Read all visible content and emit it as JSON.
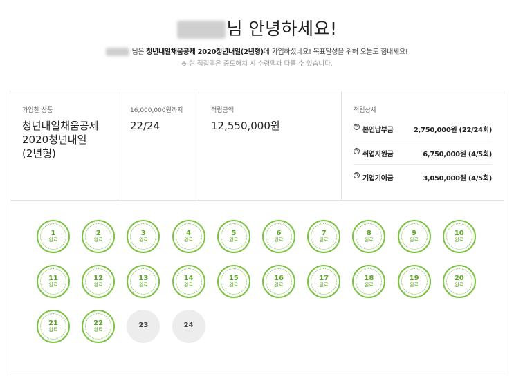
{
  "greeting": {
    "suffix": "님 안녕하세요!"
  },
  "subline": {
    "pre": "님은 ",
    "product_bold": "청년내일채움공제 2020청년내일(2년형)",
    "post": "에 가입하셨네요! 목표달성을 위해 오늘도 힘내세요!"
  },
  "notice": "※ 현 적립액은 중도해지 시 수령액과 다를 수 있습니다.",
  "summary": {
    "product": {
      "label": "가입한 상품",
      "value_lines": [
        "청년내일채움공제",
        "2020청년내일",
        "(2년형)"
      ]
    },
    "progress": {
      "label": "16,000,000원까지",
      "value": "22/24"
    },
    "amount": {
      "label": "적립금액",
      "value": "12,550,000원"
    },
    "detail": {
      "label": "적립상세",
      "rows": [
        {
          "icon": "won-icon",
          "name": "본인납부금",
          "amount": "2,750,000원 (22/24회)"
        },
        {
          "icon": "won-icon",
          "name": "취업지원금",
          "amount": "6,750,000원 (4/5회)"
        },
        {
          "icon": "won-icon",
          "name": "기업기여금",
          "amount": "3,050,000원 (4/5회)"
        }
      ]
    }
  },
  "stamps": {
    "status_label": "완료",
    "completed": 22,
    "total": 24,
    "numbers": [
      "1",
      "2",
      "3",
      "4",
      "5",
      "6",
      "7",
      "8",
      "9",
      "10",
      "11",
      "12",
      "13",
      "14",
      "15",
      "16",
      "17",
      "18",
      "19",
      "20",
      "21",
      "22",
      "23",
      "24"
    ]
  },
  "colors": {
    "accent": "#7cc243",
    "pending": "#ededed"
  }
}
